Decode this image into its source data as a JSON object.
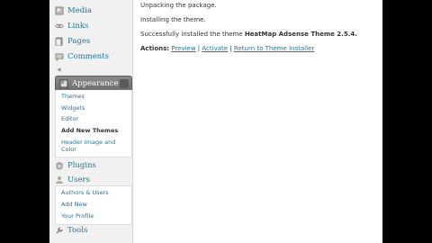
{
  "sidebar": {
    "items": [
      {
        "label": "Media",
        "icon": "media-icon"
      },
      {
        "label": "Links",
        "icon": "links-icon"
      },
      {
        "label": "Pages",
        "icon": "pages-icon"
      },
      {
        "label": "Comments",
        "icon": "comments-icon"
      }
    ],
    "appearance": {
      "label": "Appearance",
      "submenu": [
        "Themes",
        "Widgets",
        "Editor",
        "Add New Themes",
        "Header Image and Color"
      ],
      "current": "Add New Themes"
    },
    "plugins": {
      "label": "Plugins"
    },
    "users": {
      "label": "Users",
      "submenu": [
        "Authors & Users",
        "Add New",
        "Your Profile"
      ]
    },
    "tools": {
      "label": "Tools"
    }
  },
  "main": {
    "unpacking": "Unpacking the package.",
    "installing": "Installing the theme.",
    "success_prefix": "Successfully installed the theme",
    "theme_name": "HeatMap Adsense Theme 2.5.4.",
    "actions_label": "Actions:",
    "links": [
      "Preview",
      "Activate",
      "Return to Theme Installer"
    ],
    "link_separator": "|"
  },
  "colors": {
    "link": "#21759b",
    "menu_head": "#7a7a7a",
    "sidebar_bg": "#f1f1f1"
  }
}
